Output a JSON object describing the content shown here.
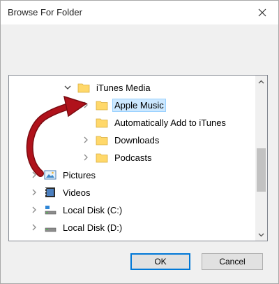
{
  "dialog": {
    "title": "Browse For Folder",
    "prompt": ""
  },
  "tree": {
    "items": [
      {
        "label": "iTunes Media",
        "icon": "folder-icon",
        "expand": "expanded",
        "indent": 2,
        "selected": false
      },
      {
        "label": "Apple Music",
        "icon": "folder-icon",
        "expand": "collapsed",
        "indent": 3,
        "selected": true
      },
      {
        "label": "Automatically Add to iTunes",
        "icon": "folder-icon",
        "expand": "none",
        "indent": 3,
        "selected": false
      },
      {
        "label": "Downloads",
        "icon": "folder-icon",
        "expand": "collapsed",
        "indent": 3,
        "selected": false
      },
      {
        "label": "Podcasts",
        "icon": "folder-icon",
        "expand": "collapsed",
        "indent": 3,
        "selected": false
      },
      {
        "label": "Pictures",
        "icon": "pictures-icon",
        "expand": "collapsed",
        "indent": 1,
        "selected": false
      },
      {
        "label": "Videos",
        "icon": "videos-icon",
        "expand": "collapsed",
        "indent": 1,
        "selected": false
      },
      {
        "label": "Local Disk (C:)",
        "icon": "system-drive-icon",
        "expand": "collapsed",
        "indent": 1,
        "selected": false
      },
      {
        "label": "Local Disk (D:)",
        "icon": "drive-icon",
        "expand": "collapsed",
        "indent": 1,
        "selected": false
      }
    ]
  },
  "buttons": {
    "ok_label": "OK",
    "cancel_label": "Cancel"
  },
  "colors": {
    "selection_bg": "#cce8ff",
    "folder": "#ffd86a",
    "annotation_arrow": "#b0121b"
  }
}
